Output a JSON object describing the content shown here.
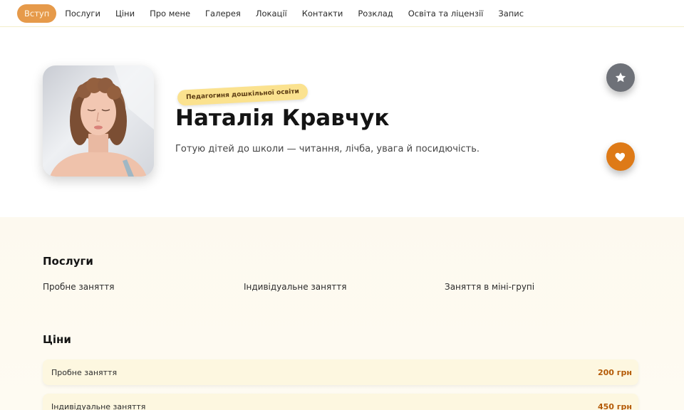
{
  "nav": {
    "items": [
      {
        "label": "Вступ",
        "active": true
      },
      {
        "label": "Послуги"
      },
      {
        "label": "Ціни"
      },
      {
        "label": "Про мене"
      },
      {
        "label": "Галерея"
      },
      {
        "label": "Локації"
      },
      {
        "label": "Контакти"
      },
      {
        "label": "Розклад"
      },
      {
        "label": "Освіта та ліцензії"
      },
      {
        "label": "Запис"
      }
    ]
  },
  "hero": {
    "badge": "Педагогиня дошкільної освіти",
    "name": "Наталія Кравчук",
    "tagline": "Готую дітей до школи — читання, лічба, увага й посидючість.",
    "avatar_icon": "portrait-photo",
    "star_icon": "star-icon",
    "heart_icon": "heart-icon"
  },
  "services": {
    "title": "Послуги",
    "items": [
      "Пробне заняття",
      "Індивідуальне заняття",
      "Заняття в міні-групі"
    ]
  },
  "prices": {
    "title": "Ціни",
    "rows": [
      {
        "label": "Пробне заняття",
        "value": "200 грн"
      },
      {
        "label": "Індивідуальне заняття",
        "value": "450 грн"
      }
    ]
  },
  "colors": {
    "accent": "#e69a4a",
    "heart": "#de7a17",
    "badge": "#fbe28f",
    "price": "#b45a06"
  }
}
